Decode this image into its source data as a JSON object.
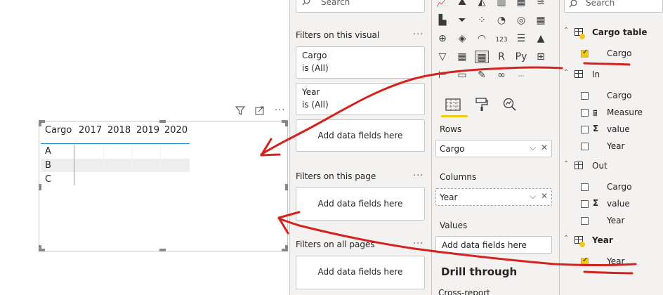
{
  "matrix": {
    "row_header": "Cargo",
    "columns": [
      "2017",
      "2018",
      "2019",
      "2020"
    ],
    "rows": [
      "A",
      "B",
      "C"
    ]
  },
  "filters": {
    "search_placeholder": "Search",
    "on_visual_title": "Filters on this visual",
    "visual_filters": [
      {
        "field": "Cargo",
        "state": "is (All)"
      },
      {
        "field": "Year",
        "state": "is (All)"
      }
    ],
    "add_fields": "Add data fields here",
    "on_page_title": "Filters on this page",
    "on_all_pages_title": "Filters on all pages",
    "more": "···"
  },
  "viz": {
    "rows_label": "Rows",
    "rows_value": "Cargo",
    "columns_label": "Columns",
    "columns_value": "Year",
    "values_label": "Values",
    "values_placeholder": "Add data fields here",
    "drill_title": "Drill through",
    "cross_report": "Cross-report",
    "icons": [
      "line-chart-icon",
      "area-chart-icon",
      "stacked-area-icon",
      "line-column-icon",
      "line-clustered-icon",
      "ribbon-chart-icon",
      "waterfall-icon",
      "funnel-icon",
      "scatter-icon",
      "pie-chart-icon",
      "donut-icon",
      "treemap-icon",
      "map-icon",
      "filled-map-icon",
      "gauge-icon",
      "card-icon",
      "multirow-card-icon",
      "kpi-icon",
      "slicer-icon",
      "table-icon",
      "matrix-icon",
      "r-visual-icon",
      "python-visual-icon",
      "key-influencers-icon",
      "decomposition-tree-icon",
      "qna-icon",
      "smart-narrative-icon",
      "paginated-icon",
      "more-visuals-icon"
    ],
    "icon_glyphs": [
      "📈",
      "⛰",
      "◭",
      "▥",
      "▦",
      "≋",
      "▙",
      "⏷",
      "⁘",
      "◔",
      "◎",
      "▦",
      "⊕",
      "◈",
      "◠",
      "123",
      "☰",
      "▲",
      "▽",
      "▦",
      "▦",
      "R",
      "Py",
      "⊞",
      "⊢",
      "▭",
      "✎",
      "∞",
      "···"
    ]
  },
  "fields": {
    "search_placeholder": "Search",
    "tables": [
      {
        "name": "Cargo table",
        "fields": [
          {
            "name": "Cargo",
            "checked": true,
            "type": "text"
          }
        ]
      },
      {
        "name": "In",
        "fields": [
          {
            "name": "Cargo",
            "checked": false,
            "type": "text"
          },
          {
            "name": "Measure",
            "checked": false,
            "type": "measure"
          },
          {
            "name": "value",
            "checked": false,
            "type": "sum"
          },
          {
            "name": "Year",
            "checked": false,
            "type": "text"
          }
        ]
      },
      {
        "name": "Out",
        "fields": [
          {
            "name": "Cargo",
            "checked": false,
            "type": "text"
          },
          {
            "name": "value",
            "checked": false,
            "type": "sum"
          },
          {
            "name": "Year",
            "checked": false,
            "type": "text"
          }
        ]
      },
      {
        "name": "Year",
        "fields": [
          {
            "name": "Year",
            "checked": true,
            "type": "text"
          }
        ]
      }
    ]
  },
  "colors": {
    "annotation": "#d4221f",
    "accent": "#f2c811",
    "matrix_line": "#1a86c8"
  }
}
